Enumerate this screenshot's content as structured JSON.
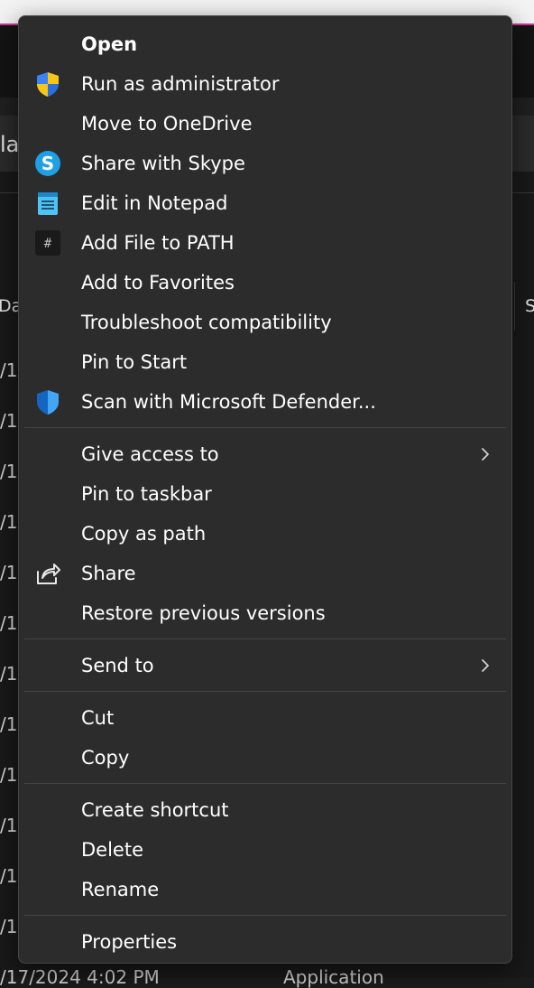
{
  "background": {
    "address_fragment": "la",
    "column_headers": [
      "Da",
      "S"
    ],
    "row_fragment": "/1",
    "bottom_row": {
      "date": "/17/2024 4:02 PM",
      "type": "Application"
    }
  },
  "menu": {
    "groups": [
      [
        {
          "label": "Open",
          "icon": null,
          "bold": true
        },
        {
          "label": "Run as administrator",
          "icon": "uac-shield-icon"
        },
        {
          "label": "Move to OneDrive",
          "icon": null
        },
        {
          "label": "Share with Skype",
          "icon": "skype-icon"
        },
        {
          "label": "Edit in Notepad",
          "icon": "notepad-icon"
        },
        {
          "label": "Add File to PATH",
          "icon": "path-hash-icon"
        },
        {
          "label": "Add to Favorites",
          "icon": null
        },
        {
          "label": "Troubleshoot compatibility",
          "icon": null
        },
        {
          "label": "Pin to Start",
          "icon": null
        },
        {
          "label": "Scan with Microsoft Defender...",
          "icon": "defender-shield-icon"
        }
      ],
      [
        {
          "label": "Give access to",
          "icon": null,
          "submenu": true
        },
        {
          "label": "Pin to taskbar",
          "icon": null
        },
        {
          "label": "Copy as path",
          "icon": null
        },
        {
          "label": "Share",
          "icon": "share-icon"
        },
        {
          "label": "Restore previous versions",
          "icon": null
        }
      ],
      [
        {
          "label": "Send to",
          "icon": null,
          "submenu": true
        }
      ],
      [
        {
          "label": "Cut",
          "icon": null
        },
        {
          "label": "Copy",
          "icon": null
        }
      ],
      [
        {
          "label": "Create shortcut",
          "icon": null
        },
        {
          "label": "Delete",
          "icon": null
        },
        {
          "label": "Rename",
          "icon": null
        }
      ],
      [
        {
          "label": "Properties",
          "icon": null
        }
      ]
    ]
  },
  "colors": {
    "menu_bg": "#2c2c2c",
    "menu_border": "#474747",
    "text": "#ffffff",
    "separator": "#434343",
    "accent_titlebar": "#c43a9b"
  }
}
